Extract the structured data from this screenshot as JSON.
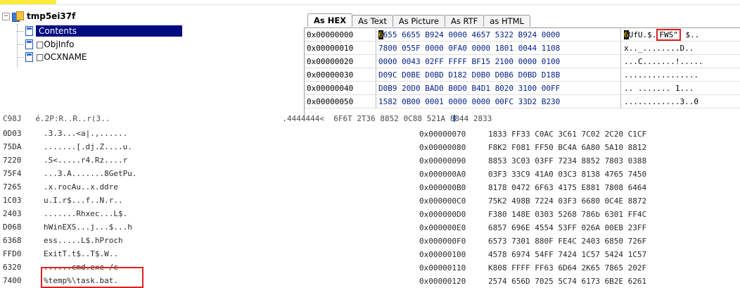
{
  "tree": {
    "root_label": "tmp5ei37f",
    "items": [
      {
        "label": "Contents",
        "selected": true
      },
      {
        "label": "□ObjInfo",
        "selected": false
      },
      {
        "label": "□OCXNAME",
        "selected": false
      }
    ]
  },
  "tabs": [
    "As HEX",
    "As Text",
    "As Picture",
    "As RTF",
    "as HTML"
  ],
  "active_tab": "As HEX",
  "hex_view": {
    "rows": [
      {
        "offset": "0x00000000",
        "bytes_rest": "655 6655 B924 0000 4657 5322 B924 0000",
        "cursor_char": "6",
        "ascii_pre": "UfU.$.",
        "ascii_boxed": "FWS\"",
        "ascii_post": " $.."
      },
      {
        "offset": "0x00000010",
        "bytes": "7800 055F 0000 0FA0 0000 1801 0044 1108",
        "ascii": "x.._........D.."
      },
      {
        "offset": "0x00000020",
        "bytes": "0000 0043 02FF FFFF BF15 2100 0000 0100",
        "ascii": "...C.......!....."
      },
      {
        "offset": "0x00000030",
        "bytes": "D09C D0BE D0BD D182 D0B0 D0B6 D0BD D18B",
        "ascii": "................"
      },
      {
        "offset": "0x00000040",
        "bytes": "D0B9 20D0 BAD0 B0D0 B4D1 8020 3100 00FF",
        "ascii": ".. ....... 1..."
      },
      {
        "offset": "0x00000050",
        "bytes": "1582 0B00 0001 0000 0000 00FC 33D2 B230",
        "ascii": "............3..0"
      }
    ]
  },
  "partial_row_text": "C98J   é.2P:R..R..r(3..                                     .4444444<  6F6T 2T36 8852 0C88 521A 8844 2833",
  "left_listing": [
    {
      "col1": "0D03",
      "col2": ".3.3...<a|.,......"
    },
    {
      "col1": "75DA",
      "col2": ".......[.dj.Z....u."
    },
    {
      "col1": "7220",
      "col2": ".S<.....r4.Rz....r"
    },
    {
      "col1": "75F4",
      "col2": "...3.A.......8GetPu."
    },
    {
      "col1": "7265",
      "col2": ".x.rocAu..x.ddre"
    },
    {
      "col1": "1C03",
      "col2": "u.I.r$...f..N.r.."
    },
    {
      "col1": "2403",
      "col2": ".......Rhxec...L$."
    },
    {
      "col1": "D068",
      "col2": "hWinEXS...j...$...h"
    },
    {
      "col1": "6368",
      "col2": "ess.....L$.hProch"
    },
    {
      "col1": "FFD0",
      "col2": "ExitT.t$..T$.W.."
    },
    {
      "col1": "6320",
      "col2": "......cmd.exe /c"
    },
    {
      "col1": "7400",
      "col2": "%temp%\\task.bat."
    }
  ],
  "right_listing": [
    {
      "offset": "0x00000070",
      "bytes": "1833 FF33 C0AC 3C61 7C02 2C20 C1CF"
    },
    {
      "offset": "0x00000080",
      "bytes": "F8K2 F081 FF50 BC4A 6A80 5A10 8812"
    },
    {
      "offset": "0x00000090",
      "bytes": "8853 3C03 03FF 7234 8852 7803 0388"
    },
    {
      "offset": "0x000000A0",
      "bytes": "03F3 33C9 41A0 03C3 8138 4765 7450"
    },
    {
      "offset": "0x000000B0",
      "bytes": "8178 0472 6F63 4175 E881 7808 6464"
    },
    {
      "offset": "0x000000C0",
      "bytes": "75K2 498B 7224 03F3 6680 0C4E 8872"
    },
    {
      "offset": "0x000000D0",
      "bytes": "F380 148E 0303 5268 786b 6301 FF4C"
    },
    {
      "offset": "0x000000E0",
      "bytes": "6857 696E 4554 53FF 026A 00EB 23FF"
    },
    {
      "offset": "0x000000F0",
      "bytes": "6573 7301 880F FE4C 2403 6850 726F"
    },
    {
      "offset": "0x00000100",
      "bytes": "4578 6974 54FF 7424 1C57 5424 1C57"
    },
    {
      "offset": "0x00000110",
      "bytes": "K808 FFFF FF63 6D64 2K65 7865 202F"
    },
    {
      "offset": "0x00000120",
      "bytes": "2574 656D 7025 5C74 6173 6B2E 6261"
    }
  ],
  "colors": {
    "selection": "#000a80",
    "highlight_box": "#e02020",
    "hex_bytes": "#001f8a",
    "top_strip": "#ffec3d"
  }
}
